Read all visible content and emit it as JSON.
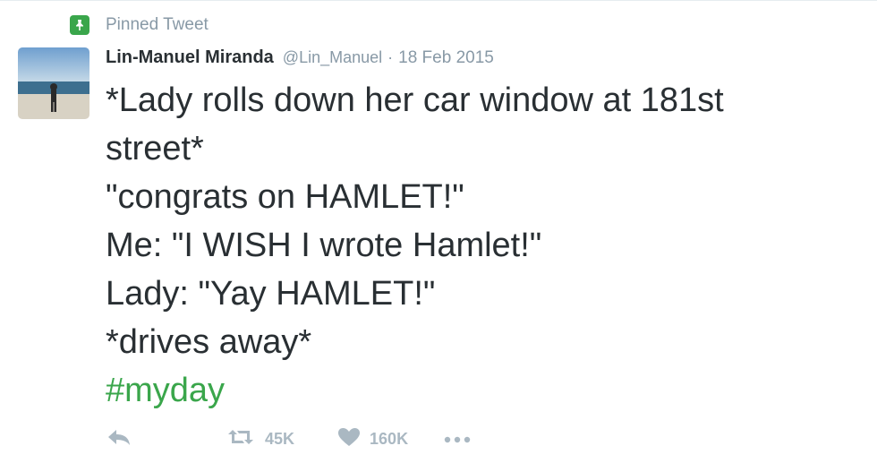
{
  "pinned": {
    "label": "Pinned Tweet",
    "icon": "pin-icon",
    "color": "#3aa64b"
  },
  "author": {
    "display_name": "Lin-Manuel Miranda",
    "screen_name": "@Lin_Manuel",
    "separator": "·",
    "date": "18 Feb 2015",
    "avatar": "avatar-photo"
  },
  "tweet": {
    "lines": [
      "*Lady rolls down her car window at 181st",
      "street*",
      "\"congrats on HAMLET!\"",
      "Me: \"I WISH I wrote Hamlet!\"",
      "Lady: \"Yay HAMLET!\"",
      "*drives away*"
    ],
    "hashtag": "#myday",
    "hashtag_color": "#3aa64b"
  },
  "actions": {
    "reply_icon": "reply-icon",
    "retweet_icon": "retweet-icon",
    "retweet_count": "45K",
    "like_icon": "heart-icon",
    "like_count": "160K",
    "more_icon": "more-icon"
  }
}
